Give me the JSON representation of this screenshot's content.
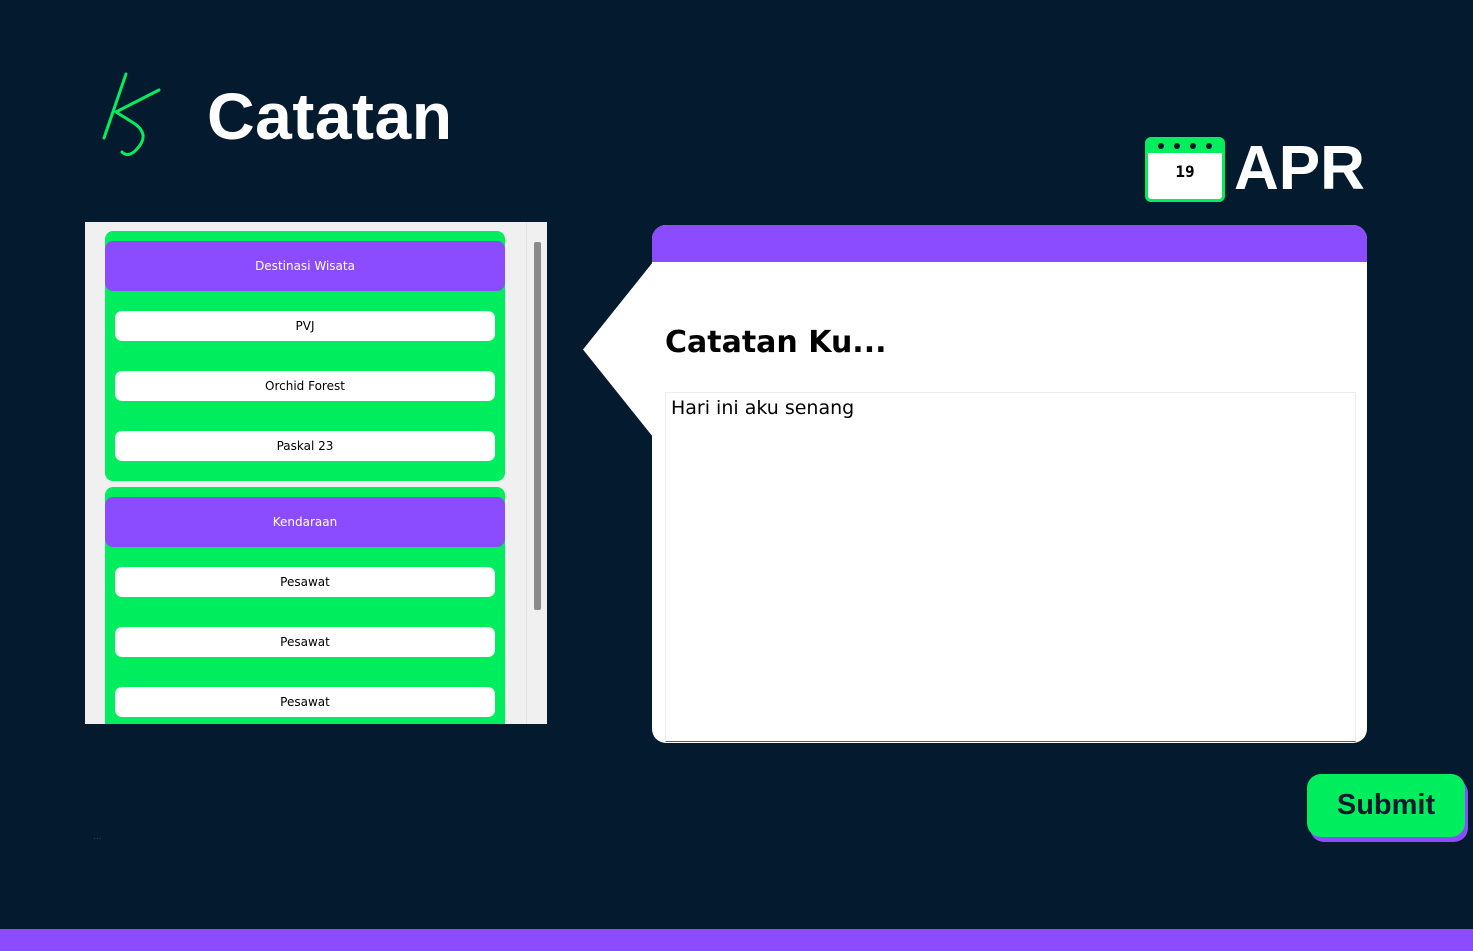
{
  "header": {
    "logo_icon": "kj-logo-icon",
    "title": "Catatan"
  },
  "date": {
    "icon": "calendar-icon",
    "day": "19",
    "month": "APR"
  },
  "lists": {
    "groups": [
      {
        "title": "Destinasi Wisata",
        "items": [
          "PVJ",
          "Orchid Forest",
          "Paskal 23"
        ]
      },
      {
        "title": "Kendaraan",
        "items": [
          "Pesawat",
          "Pesawat",
          "Pesawat"
        ]
      }
    ]
  },
  "note": {
    "title": "Catatan Ku...",
    "text": "Hari ini aku senang"
  },
  "actions": {
    "submit_label": "Submit"
  },
  "footer": {
    "dots": "..."
  },
  "colors": {
    "background": "#041a2f",
    "accent_green": "#00ee5e",
    "accent_purple": "#8b4cff"
  }
}
